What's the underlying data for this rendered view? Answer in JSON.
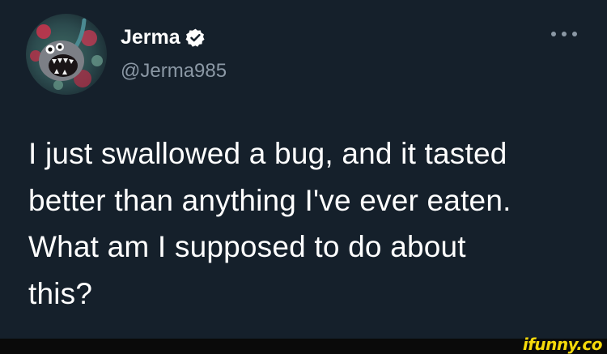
{
  "author": {
    "name": "Jerma",
    "handle": "@Jerma985",
    "verified": true,
    "avatar": "avatar-image"
  },
  "menu": {
    "icon": "more-horizontal-icon"
  },
  "tweet": {
    "lines": [
      "I just swallowed a bug, and it tasted",
      "better than anything I've ever eaten.",
      "What am I supposed to do about",
      "this?"
    ]
  },
  "watermark": {
    "text": "ifunny.co"
  },
  "colors": {
    "background": "#15202b",
    "text": "#ffffff",
    "secondary_text": "#8b98a5",
    "verified_badge": "#ffffff",
    "watermark": "#f5d90a"
  }
}
